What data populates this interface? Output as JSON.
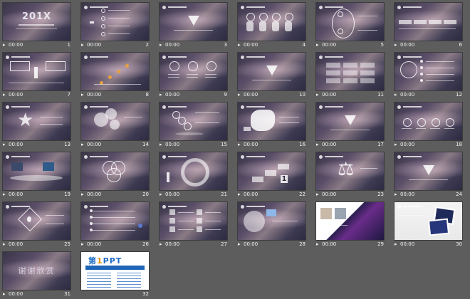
{
  "cover": {
    "title": "201X"
  },
  "closing": {
    "title": "谢谢欣赏"
  },
  "brand_slide": {
    "brand_left": "第",
    "brand_mid": "1",
    "brand_right": "PPT"
  },
  "slides": [
    {
      "num": "1",
      "time": "00:00",
      "play_icon": "play-icon",
      "kind": "cover"
    },
    {
      "num": "2",
      "time": "00:00",
      "play_icon": "play-icon",
      "kind": "list"
    },
    {
      "num": "3",
      "time": "00:00",
      "play_icon": "play-icon",
      "kind": "triangle"
    },
    {
      "num": "4",
      "time": "00:00",
      "play_icon": "play-icon",
      "kind": "pills"
    },
    {
      "num": "5",
      "time": "00:00",
      "play_icon": "play-icon",
      "kind": "curve"
    },
    {
      "num": "6",
      "time": "00:00",
      "play_icon": "play-icon",
      "kind": "arrows"
    },
    {
      "num": "7",
      "time": "00:00",
      "play_icon": "play-icon",
      "kind": "boxes"
    },
    {
      "num": "8",
      "time": "00:00",
      "play_icon": "play-icon",
      "kind": "steps"
    },
    {
      "num": "9",
      "time": "00:00",
      "play_icon": "play-icon",
      "kind": "rings"
    },
    {
      "num": "10",
      "time": "00:00",
      "play_icon": "play-icon",
      "kind": "triangle"
    },
    {
      "num": "11",
      "time": "00:00",
      "play_icon": "play-icon",
      "kind": "table"
    },
    {
      "num": "12",
      "time": "00:00",
      "play_icon": "play-icon",
      "kind": "radial"
    },
    {
      "num": "13",
      "time": "00:00",
      "play_icon": "play-icon",
      "kind": "star"
    },
    {
      "num": "14",
      "time": "00:00",
      "play_icon": "play-icon",
      "kind": "bubbles"
    },
    {
      "num": "15",
      "time": "00:00",
      "play_icon": "play-icon",
      "kind": "dots"
    },
    {
      "num": "16",
      "time": "00:00",
      "play_icon": "play-icon",
      "kind": "map"
    },
    {
      "num": "17",
      "time": "00:00",
      "play_icon": "play-icon",
      "kind": "triangle"
    },
    {
      "num": "18",
      "time": "00:00",
      "play_icon": "play-icon",
      "kind": "icons"
    },
    {
      "num": "19",
      "time": "00:00",
      "play_icon": "play-icon",
      "kind": "photos"
    },
    {
      "num": "20",
      "time": "00:00",
      "play_icon": "play-icon",
      "kind": "venn"
    },
    {
      "num": "21",
      "time": "00:00",
      "play_icon": "play-icon",
      "kind": "cycle"
    },
    {
      "num": "22",
      "time": "00:00",
      "play_icon": "play-icon",
      "kind": "stairs"
    },
    {
      "num": "23",
      "time": "00:00",
      "play_icon": "play-icon",
      "kind": "scale"
    },
    {
      "num": "24",
      "time": "00:00",
      "play_icon": "play-icon",
      "kind": "triangle"
    },
    {
      "num": "25",
      "time": "00:00",
      "play_icon": "play-icon",
      "kind": "diamond"
    },
    {
      "num": "26",
      "time": "00:00",
      "play_icon": "play-icon",
      "kind": "timeline"
    },
    {
      "num": "27",
      "time": "00:00",
      "play_icon": "play-icon",
      "kind": "iconlist"
    },
    {
      "num": "28",
      "time": "00:00",
      "play_icon": "play-icon",
      "kind": "pie"
    },
    {
      "num": "29",
      "time": "00:00",
      "play_icon": "play-icon",
      "kind": "photo"
    },
    {
      "num": "30",
      "time": "00:00",
      "play_icon": "play-icon",
      "kind": "cards"
    },
    {
      "num": "31",
      "time": "00:00",
      "play_icon": "play-icon",
      "kind": "closing"
    },
    {
      "num": "32",
      "time": "",
      "play_icon": "",
      "kind": "brand"
    }
  ],
  "colors": {
    "page_bg": "#5d5d5d",
    "slide_dark": "#3a3548",
    "slide_accent": "#8a7a85",
    "footer_text": "#f3f3f3",
    "brand_blue": "#1f6cc4",
    "brand_orange": "#e08a00"
  }
}
